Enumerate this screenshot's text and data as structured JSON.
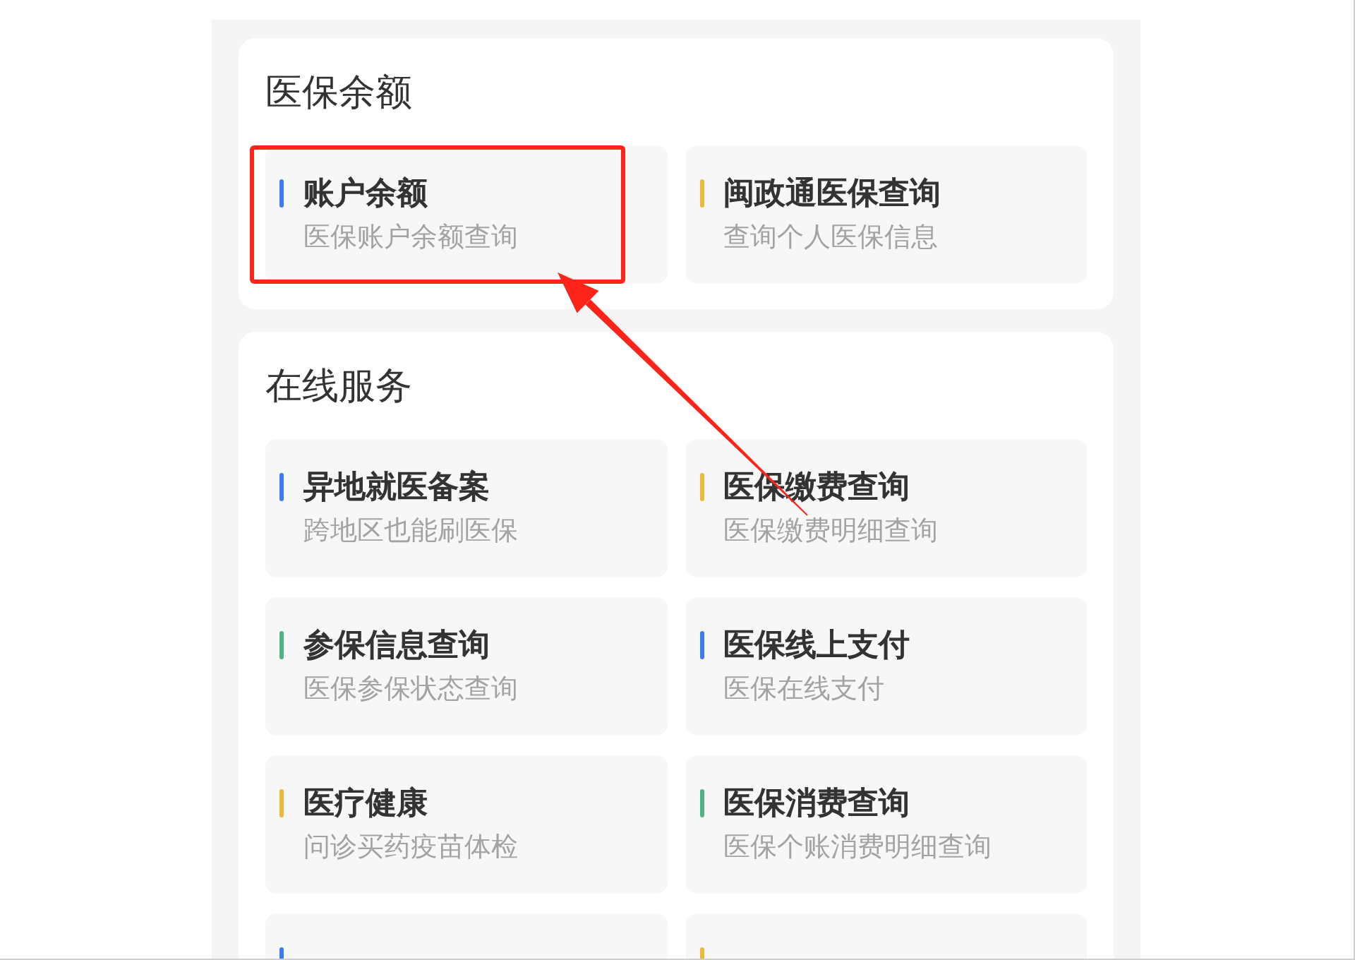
{
  "sections": [
    {
      "title": "医保余额",
      "items": [
        {
          "title": "账户余额",
          "subtitle": "医保账户余额查询",
          "color": "#3d7bf2",
          "highlighted": true
        },
        {
          "title": "闽政通医保查询",
          "subtitle": "查询个人医保信息",
          "color": "#e9b83c",
          "highlighted": false
        }
      ]
    },
    {
      "title": "在线服务",
      "items": [
        {
          "title": "异地就医备案",
          "subtitle": "跨地区也能刷医保",
          "color": "#3d7bf2",
          "highlighted": false
        },
        {
          "title": "医保缴费查询",
          "subtitle": "医保缴费明细查询",
          "color": "#e9b83c",
          "highlighted": false
        },
        {
          "title": "参保信息查询",
          "subtitle": "医保参保状态查询",
          "color": "#52b283",
          "highlighted": false
        },
        {
          "title": "医保线上支付",
          "subtitle": "医保在线支付",
          "color": "#3d7bf2",
          "highlighted": false
        },
        {
          "title": "医疗健康",
          "subtitle": "问诊买药疫苗体检",
          "color": "#e9b83c",
          "highlighted": false
        },
        {
          "title": "医保消费查询",
          "subtitle": "医保个账消费明细查询",
          "color": "#52b283",
          "highlighted": false
        },
        {
          "color": "#3d7bf2",
          "highlighted": false
        },
        {
          "color": "#e9b83c",
          "highlighted": false
        }
      ]
    }
  ]
}
